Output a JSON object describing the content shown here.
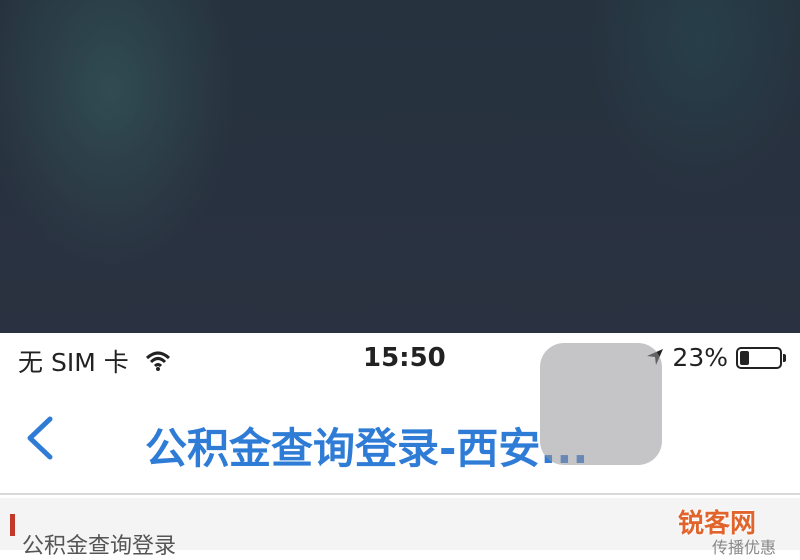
{
  "status_bar": {
    "carrier": "无 SIM 卡",
    "wifi_icon": "wifi-icon",
    "time": "15:50",
    "location_icon": "location-arrow-icon",
    "battery_percent": "23%",
    "battery_level": 0.23
  },
  "nav": {
    "back_icon": "chevron-left-icon",
    "title": "公积金查询登录-西安..."
  },
  "content": {
    "title": "公积金查询登录",
    "right_text": "传播优惠"
  },
  "watermark": "锐客网",
  "colors": {
    "accent": "#2e7cd6",
    "backdrop": "#28313f",
    "watermark": "#e0642b"
  }
}
